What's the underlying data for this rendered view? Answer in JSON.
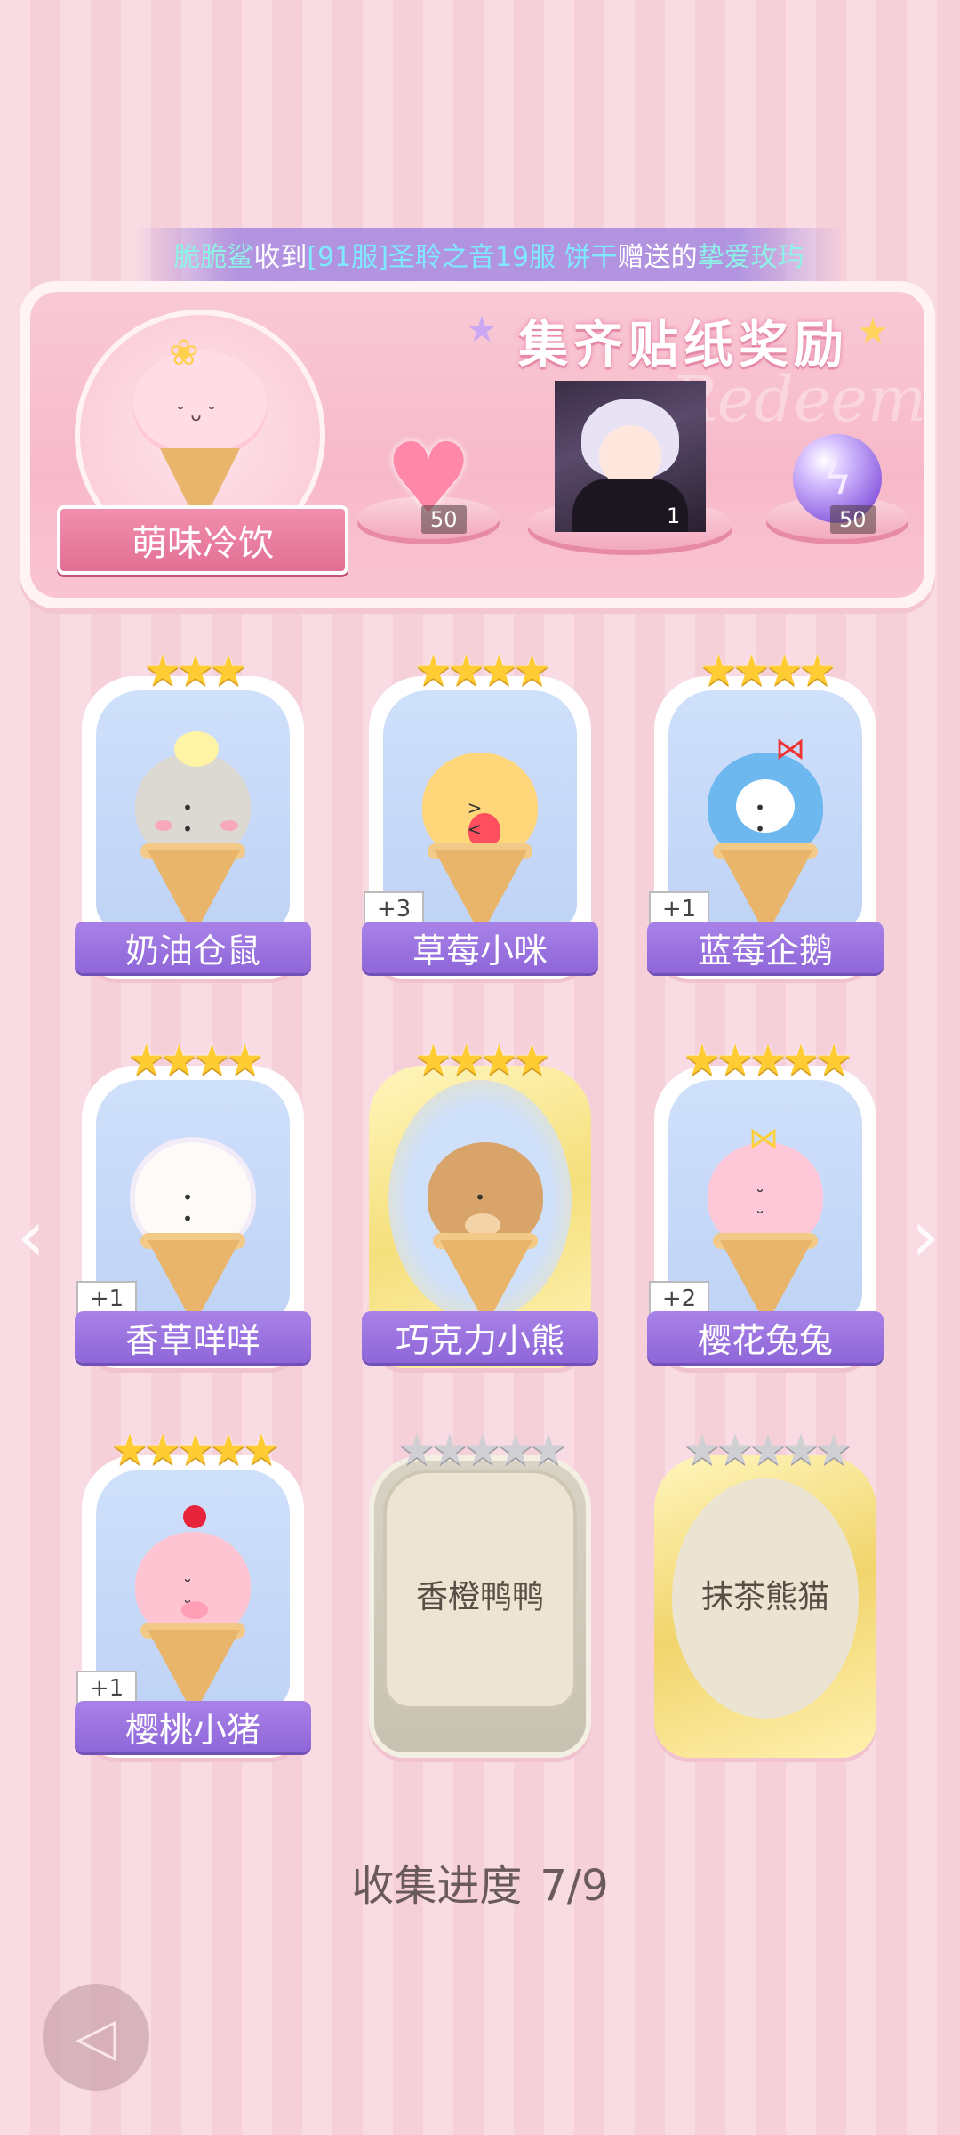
{
  "marquee": {
    "user": "脆脆鲨",
    "received": "收到",
    "server": "[91服]圣聆之音19服 饼干",
    "gift": "赠送的",
    "item": "挚爱玫玙"
  },
  "banner": {
    "title": "集齐贴纸奖励",
    "watermark": "Redeem",
    "collection_name": "萌味冷饮",
    "rewards": [
      {
        "icon": "heart-gem-icon",
        "count": "50"
      },
      {
        "icon": "character-portrait",
        "count": "1"
      },
      {
        "icon": "energy-orb-icon",
        "count": "50"
      }
    ]
  },
  "cards": [
    {
      "name": "奶油仓鼠",
      "stars": 3,
      "badge": "",
      "collected": true
    },
    {
      "name": "草莓小咪",
      "stars": 4,
      "badge": "+3",
      "collected": true
    },
    {
      "name": "蓝莓企鹅",
      "stars": 4,
      "badge": "+1",
      "collected": true
    },
    {
      "name": "香草咩咩",
      "stars": 4,
      "badge": "+1",
      "collected": true
    },
    {
      "name": "巧克力小熊",
      "stars": 4,
      "badge": "",
      "collected": true
    },
    {
      "name": "樱花兔兔",
      "stars": 5,
      "badge": "+2",
      "collected": true
    },
    {
      "name": "樱桃小猪",
      "stars": 5,
      "badge": "+1",
      "collected": true
    },
    {
      "name": "香橙鸭鸭",
      "stars": 5,
      "badge": "",
      "collected": false
    },
    {
      "name": "抹茶熊猫",
      "stars": 5,
      "badge": "",
      "collected": false
    }
  ],
  "progress": {
    "label": "收集进度",
    "value": "7/9"
  },
  "icons": {
    "prev": "chevron-left-icon",
    "next": "chevron-right-icon",
    "back": "back-icon"
  },
  "colors": {
    "name_plate": "#8e66d8",
    "star": "#ffcc33",
    "accent": "#f38fae"
  }
}
